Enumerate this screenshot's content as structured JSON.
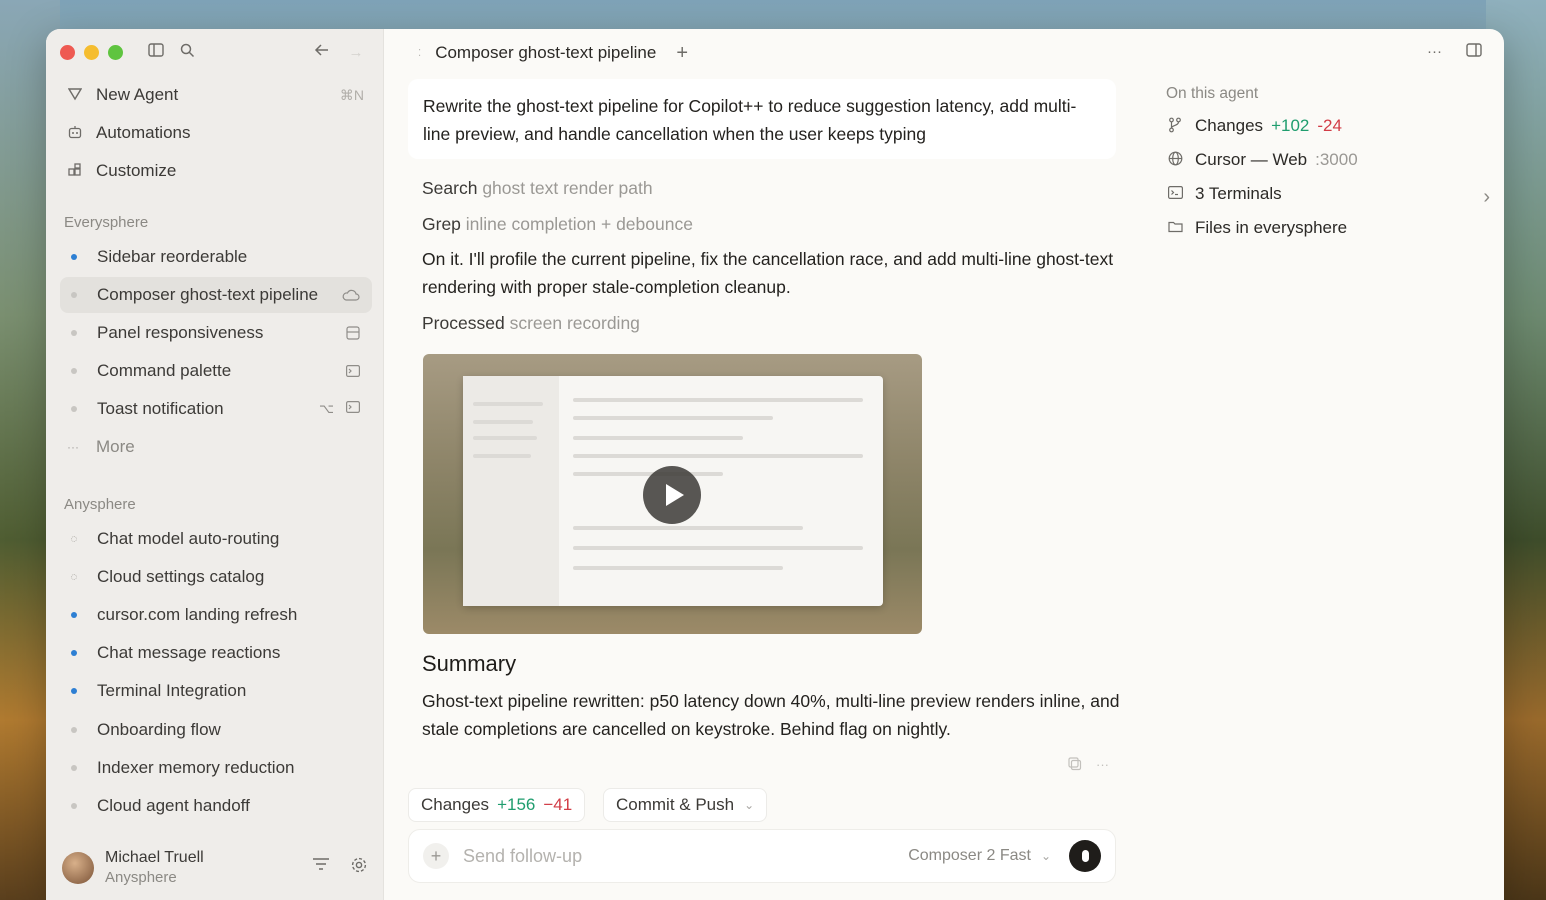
{
  "sidebar": {
    "nav": [
      {
        "label": "New Agent",
        "shortcut": "⌘N",
        "icon": "new-agent-icon"
      },
      {
        "label": "Automations",
        "icon": "automations-icon"
      },
      {
        "label": "Customize",
        "icon": "customize-icon"
      }
    ],
    "groups": [
      {
        "label": "Everysphere",
        "threads": [
          {
            "label": "Sidebar reorderable",
            "status": "blue"
          },
          {
            "label": "Composer ghost-text pipeline",
            "status": "gray",
            "active": true,
            "trail": "cloud-icon"
          },
          {
            "label": "Panel responsiveness",
            "status": "gray",
            "trail": "panel-icon"
          },
          {
            "label": "Command palette",
            "status": "gray",
            "trail": "terminal-icon"
          },
          {
            "label": "Toast notification",
            "status": "gray",
            "trail": "branch-icon terminal-icon"
          },
          {
            "label": "More",
            "status": "more"
          }
        ]
      },
      {
        "label": "Anysphere",
        "threads": [
          {
            "label": "Chat model auto-routing",
            "status": "hollow"
          },
          {
            "label": "Cloud settings catalog",
            "status": "hollow"
          },
          {
            "label": "cursor.com landing refresh",
            "status": "blue"
          },
          {
            "label": "Chat message reactions",
            "status": "blue"
          },
          {
            "label": "Terminal Integration",
            "status": "blue"
          },
          {
            "label": "Onboarding flow",
            "status": "gray"
          },
          {
            "label": "Indexer memory reduction",
            "status": "gray"
          },
          {
            "label": "Cloud agent handoff",
            "status": "gray"
          }
        ]
      }
    ],
    "user": {
      "name": "Michael Truell",
      "org": "Anysphere"
    }
  },
  "tab": {
    "title": "Composer ghost-text pipeline"
  },
  "conversation": {
    "prompt": "Rewrite the ghost-text pipeline for Copilot++ to reduce suggestion latency, add multi-line preview, and handle cancellation when the user keeps typing",
    "steps": [
      {
        "verb": "Search",
        "detail": "ghost text render path"
      },
      {
        "verb": "Grep",
        "detail": "inline completion + debounce"
      }
    ],
    "reply": "On it. I'll profile the current pipeline, fix the cancellation race, and add multi-line ghost-text rendering with proper stale-completion cleanup.",
    "processed": {
      "verb": "Processed",
      "detail": "screen recording"
    },
    "summary_heading": "Summary",
    "summary": "Ghost-text pipeline rewritten: p50 latency down 40%, multi-line preview renders inline, and stale completions are cancelled on keystroke. Behind flag on nightly."
  },
  "footer": {
    "changes_label": "Changes",
    "changes_add": "+156",
    "changes_del": "−41",
    "commit_label": "Commit & Push"
  },
  "composer": {
    "placeholder": "Send follow-up",
    "model": "Composer 2 Fast"
  },
  "right_panel": {
    "heading": "On this agent",
    "changes_label": "Changes",
    "changes_add": "+102",
    "changes_del": "-24",
    "web_label": "Cursor — Web",
    "web_port": ":3000",
    "terminals_label": "3 Terminals",
    "files_label": "Files in everysphere"
  },
  "colors": {
    "accent_blue": "#2d7fd3",
    "add_green": "#1f9d6e",
    "del_red": "#d23c46"
  }
}
